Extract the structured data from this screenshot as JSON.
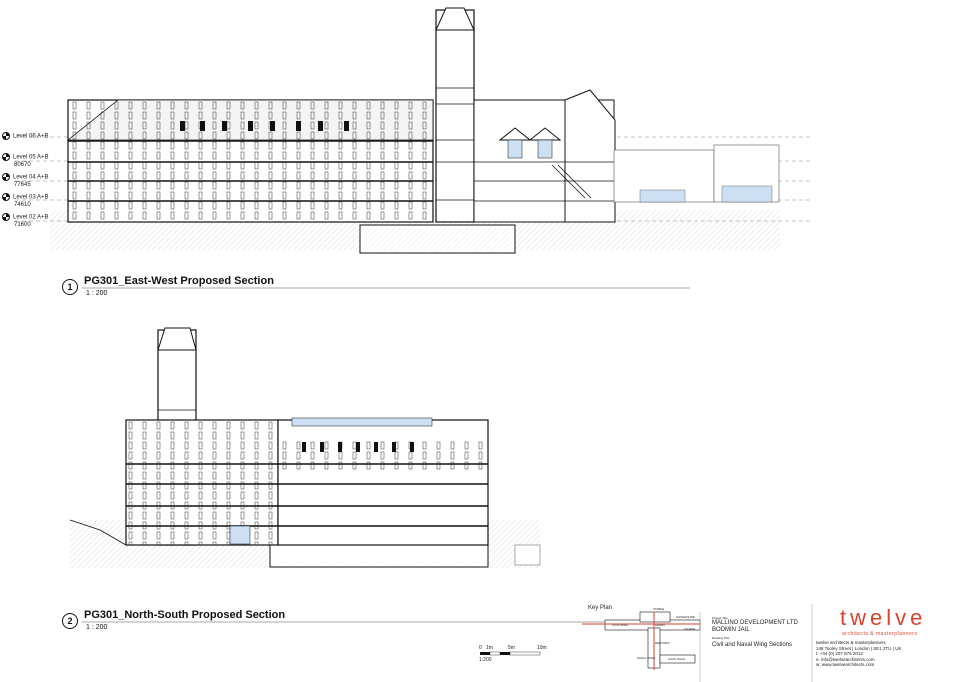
{
  "section1": {
    "number": "1",
    "title": "PG301_East-West Proposed Section",
    "scale": "1 : 200",
    "levels": [
      {
        "name": "Level 06 A+B",
        "value": ""
      },
      {
        "name": "Level 05 A+B",
        "value": "80670"
      },
      {
        "name": "Level 04 A+B",
        "value": "77645"
      },
      {
        "name": "Level 03 A+B",
        "value": "74610"
      },
      {
        "name": "Level 02 A+B",
        "value": "71600"
      }
    ]
  },
  "section2": {
    "number": "2",
    "title": "PG301_North-South Proposed Section",
    "scale": "1 : 200"
  },
  "scale_bar": {
    "labels": [
      "0",
      "1m",
      "5m",
      "10m"
    ],
    "ratio": "1:200"
  },
  "key_plan": {
    "label": "Key Plan",
    "rooms": [
      "STABLE",
      "CIVIL WING",
      "ADMIN",
      "GATEHOUSE",
      "NAVAL WING",
      "CHAPEL",
      "DEBTORS",
      "GAOL WALK"
    ]
  },
  "project": {
    "project_title_label": "Project Title",
    "client": "MALLINO DEVELOPMENT LTD",
    "site": "BODMIN JAIL",
    "drawing_title_label": "Drawing Title",
    "drawing_title": "Civil and Naval Wing Sections"
  },
  "brand": {
    "logo": "twelve",
    "tagline": "architects & masterplanners",
    "colour": "#d9422b",
    "lines": [
      "twelve architects & masterplanners",
      "148 Tooley Street | London | SE1 2TU | UK",
      "t: +44 (0) 207 876 2012",
      "e: info@twelvearchitects.com",
      "w: www.twelvearchitects.com"
    ]
  }
}
